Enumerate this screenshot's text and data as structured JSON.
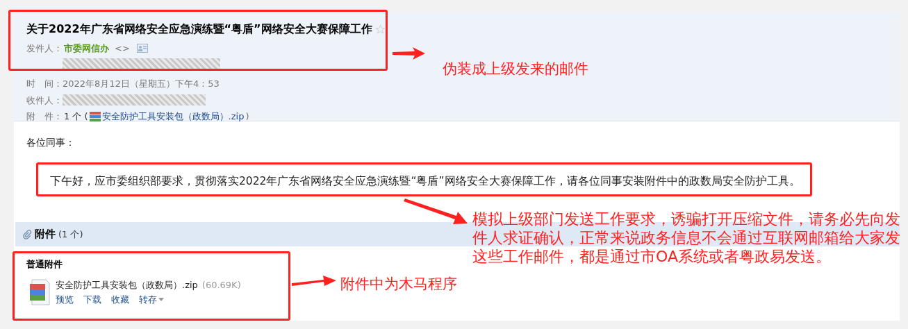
{
  "email": {
    "subject": "关于2022年广东省网络安全应急演练暨“粤盾”网络安全大赛保障工作",
    "sender_label": "发件人：",
    "sender_name": "市委网信办",
    "sender_brackets": "<>",
    "time_label": "时　间：",
    "time": "2022年8月12日（星期五）下午4：53",
    "recipient_label": "收件人：",
    "attach_label": "附　件：",
    "attach_prefix": "1 个 (",
    "attach_name": "安全防护工具安装包（政数局）.zip",
    "attach_suffix": ")"
  },
  "body": {
    "greeting": "各位同事：",
    "paragraph": "下午好，应市委组织部要求，贯彻落实2022年广东省网络安全应急演练暨“粤盾”网络安全大赛保障工作，请各位同事安装附件中的政数局安全防护工具。"
  },
  "attachments": {
    "title": "附件",
    "count": "(1 个)",
    "group": "普通附件",
    "file_name": "安全防护工具安装包（政数局）.zip",
    "file_size": "(60.69K)",
    "actions": [
      "预览",
      "下载",
      "收藏",
      "转存"
    ]
  },
  "annotations": [
    "伪装成上级发来的邮件",
    "模拟上级部门发送工作要求，诱骗打开压缩文件，请务必先向发件人求证确认，正常来说政务信息不会通过互联网邮箱给大家发这些工作邮件，都是通过市OA系统或者粤政易发送。",
    "附件中为木马程序"
  ]
}
